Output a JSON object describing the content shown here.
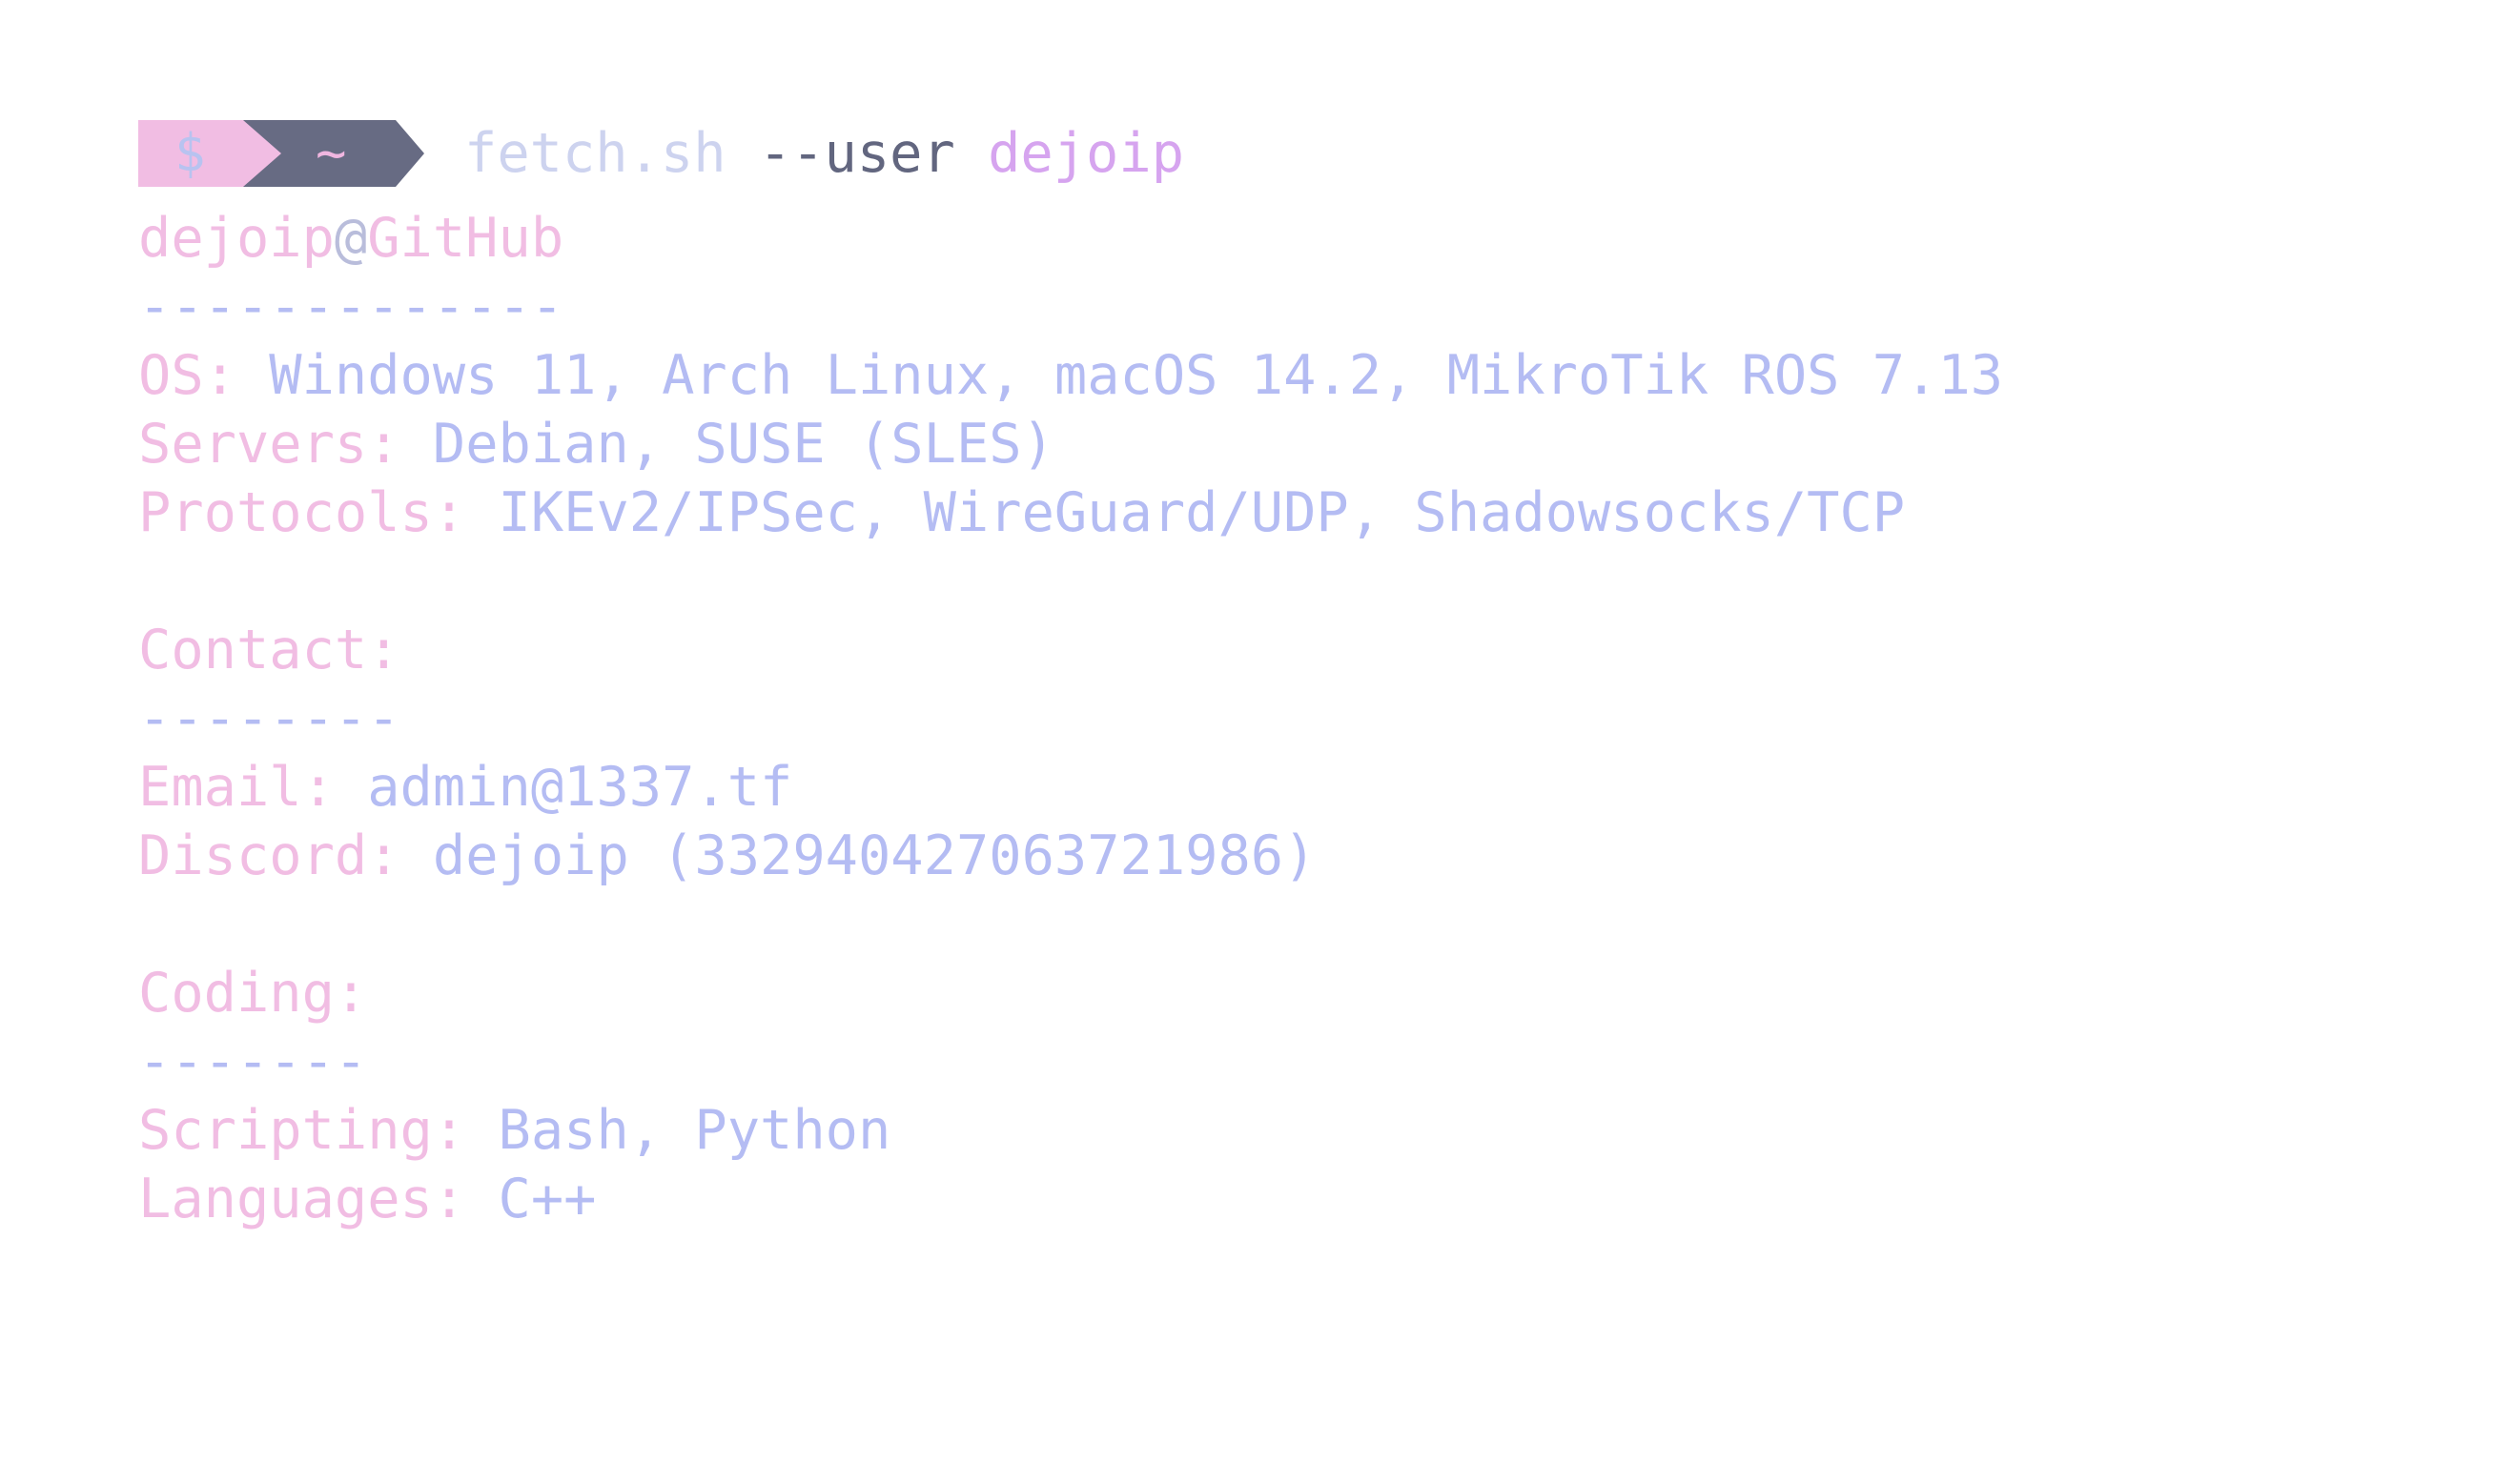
{
  "colors": {
    "pink": "#f1bde3",
    "blue": "#b4bcf3",
    "prompt_dark": "#676b83",
    "prompt_dollar": "#b8c3f0",
    "prompt_tilde": "#f0b6e0",
    "script_color": "#cdd3ef",
    "flag_color": "#62667f",
    "arg_color": "#d6a4ef",
    "at_color": "#b9bddb"
  },
  "prompt": {
    "dollar": "$",
    "tilde": "~"
  },
  "command": {
    "script": "fetch.sh",
    "flag": "--user",
    "arg": "dejoip"
  },
  "header": {
    "user": "dejoip",
    "at": "@",
    "host": "GitHub",
    "underline": "-------------"
  },
  "system": {
    "os_label": "OS:",
    "os_value": "Windows 11, Arch Linux, macOS 14.2, MikroTik ROS 7.13",
    "servers_label": "Servers:",
    "servers_value": "Debian, SUSE (SLES)",
    "protocols_label": "Protocols:",
    "protocols_value": "IKEv2/IPSec, WireGuard/UDP, Shadowsocks/TCP"
  },
  "contact": {
    "title": "Contact:",
    "underline": "--------",
    "email_label": "Email:",
    "email_value": "admin@1337.tf",
    "discord_label": "Discord:",
    "discord_value": "dejoip (332940427063721986)"
  },
  "coding": {
    "title": "Coding:",
    "underline": "-------",
    "scripting_label": "Scripting:",
    "scripting_value": "Bash, Python",
    "languages_label": "Languages:",
    "languages_value": "C++"
  }
}
